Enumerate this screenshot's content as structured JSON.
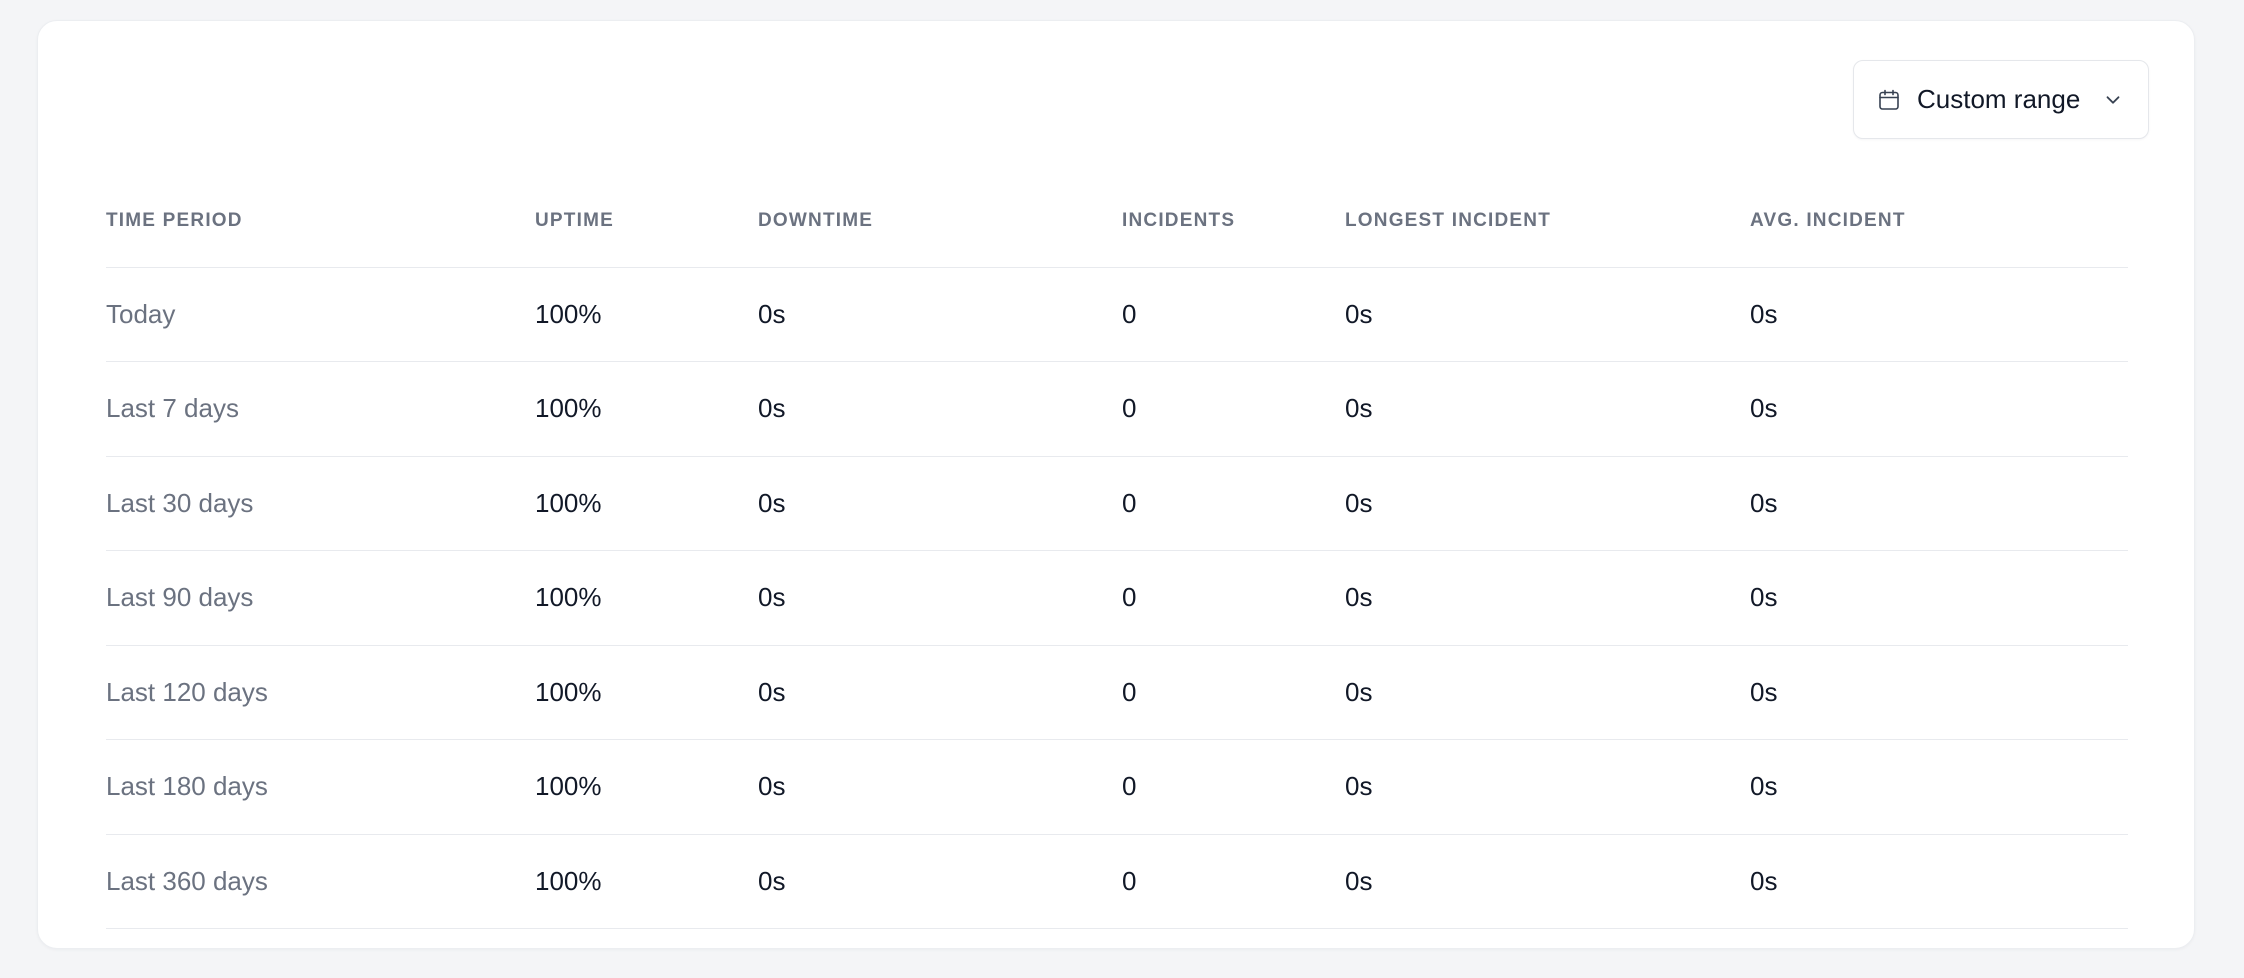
{
  "controls": {
    "range_label": "Custom range",
    "calendar_icon": "calendar-icon",
    "chevron_icon": "chevron-down-icon"
  },
  "table": {
    "headers": {
      "period": "TIME PERIOD",
      "uptime": "UPTIME",
      "downtime": "DOWNTIME",
      "incidents": "INCIDENTS",
      "longest": "LONGEST INCIDENT",
      "avg": "AVG. INCIDENT"
    },
    "rows": [
      {
        "period": "Today",
        "uptime": "100%",
        "downtime": "0s",
        "incidents": "0",
        "longest": "0s",
        "avg": "0s"
      },
      {
        "period": "Last 7 days",
        "uptime": "100%",
        "downtime": "0s",
        "incidents": "0",
        "longest": "0s",
        "avg": "0s"
      },
      {
        "period": "Last 30 days",
        "uptime": "100%",
        "downtime": "0s",
        "incidents": "0",
        "longest": "0s",
        "avg": "0s"
      },
      {
        "period": "Last 90 days",
        "uptime": "100%",
        "downtime": "0s",
        "incidents": "0",
        "longest": "0s",
        "avg": "0s"
      },
      {
        "period": "Last 120 days",
        "uptime": "100%",
        "downtime": "0s",
        "incidents": "0",
        "longest": "0s",
        "avg": "0s"
      },
      {
        "period": "Last 180 days",
        "uptime": "100%",
        "downtime": "0s",
        "incidents": "0",
        "longest": "0s",
        "avg": "0s"
      },
      {
        "period": "Last 360 days",
        "uptime": "100%",
        "downtime": "0s",
        "incidents": "0",
        "longest": "0s",
        "avg": "0s"
      }
    ]
  },
  "colors": {
    "page_bg": "#f4f5f7",
    "card_bg": "#ffffff",
    "muted_text": "#6b7280",
    "primary_text": "#111827",
    "divider": "#e8eaee"
  }
}
